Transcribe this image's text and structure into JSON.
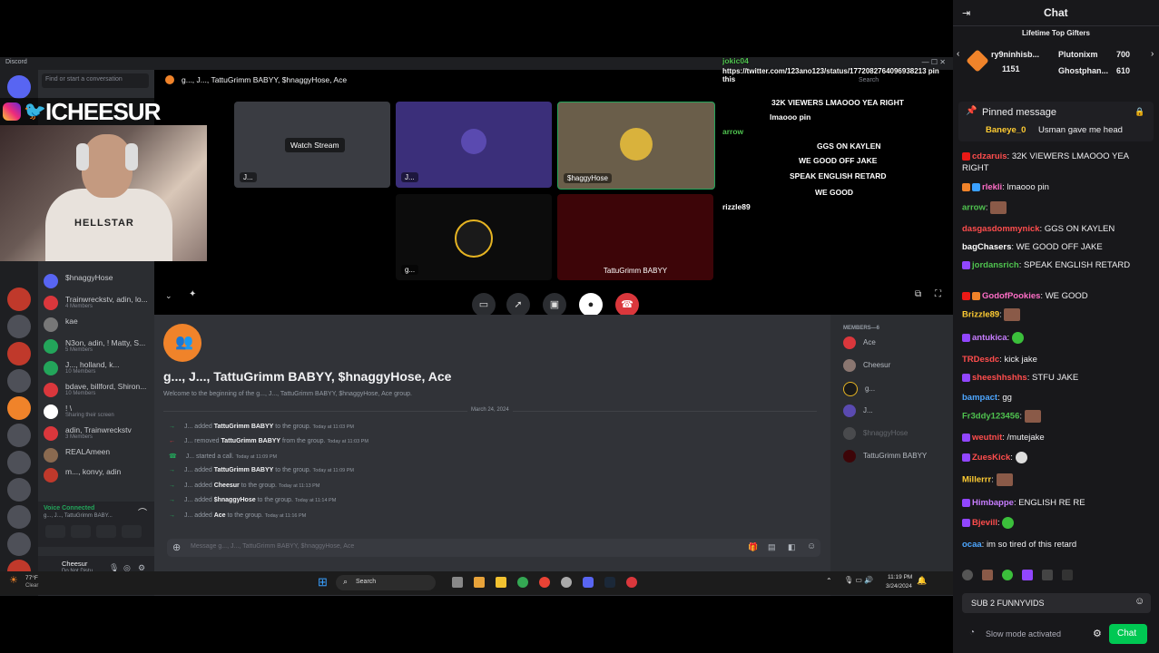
{
  "discord": {
    "brand": "Discord",
    "search_placeholder": "Find or start a conversation",
    "channel_title": "g..., J..., TattuGrimm BABYY, $hnaggyHose, Ace",
    "top_right_search": "Search",
    "dm_list": [
      {
        "name": "$hnaggyHose",
        "sub": ""
      },
      {
        "name": "Trainwreckstv, adin, lo...",
        "sub": "4 Members"
      },
      {
        "name": "kae",
        "sub": ""
      },
      {
        "name": "N3on, adin, ! Matty, S...",
        "sub": "5 Members"
      },
      {
        "name": "J..., holland, k...",
        "sub": "10 Members"
      },
      {
        "name": "bdave, billford, Shiron...",
        "sub": "10 Members"
      },
      {
        "name": "! \\",
        "sub": "Sharing their screen"
      },
      {
        "name": "adin, Trainwreckstv",
        "sub": "3 Members"
      },
      {
        "name": "REALAmeen",
        "sub": ""
      },
      {
        "name": "m..., konvy, adin",
        "sub": ""
      }
    ],
    "voice_connected": "Voice Connected",
    "voice_channel": "g..., J..., TattuGrimm BABY...",
    "user_name": "Cheesur",
    "user_status": "Do Not Distu...",
    "tiles": {
      "watch_stream": "Watch Stream",
      "tile1_label": "J...",
      "tile2_label": "J...",
      "tile3_label": "$haggyHose",
      "tile4_label": "g...",
      "tile5_label": "TattuGrimm BABYY"
    },
    "group_title": "g..., J..., TattuGrimm BABYY, $hnaggyHose, Ace",
    "group_welcome": "Welcome to the beginning of the g..., J..., TattuGrimm BABYY, $hnaggyHose, Ace group.",
    "date_divider": "March 24, 2024",
    "system_messages": [
      {
        "who": "J...",
        "action": "added",
        "target": "TattuGrimm BABYY",
        "rest": "to the group.",
        "time": "Today at 11:03 PM",
        "kind": "join"
      },
      {
        "who": "J...",
        "action": "removed",
        "target": "TattuGrimm BABYY",
        "rest": "from the group.",
        "time": "Today at 11:03 PM",
        "kind": "leave"
      },
      {
        "who": "J...",
        "action": "started a call.",
        "target": "",
        "rest": "",
        "time": "Today at 11:09 PM",
        "kind": "call"
      },
      {
        "who": "J...",
        "action": "added",
        "target": "TattuGrimm BABYY",
        "rest": "to the group.",
        "time": "Today at 11:09 PM",
        "kind": "join"
      },
      {
        "who": "J...",
        "action": "added",
        "target": "Cheesur",
        "rest": "to the group.",
        "time": "Today at 11:13 PM",
        "kind": "join"
      },
      {
        "who": "J...",
        "action": "added",
        "target": "$hnaggyHose",
        "rest": "to the group.",
        "time": "Today at 11:14 PM",
        "kind": "join"
      },
      {
        "who": "J...",
        "action": "added",
        "target": "Ace",
        "rest": "to the group.",
        "time": "Today at 11:16 PM",
        "kind": "join"
      }
    ],
    "message_placeholder": "Message g..., J..., TattuGrimm BABYY, $hnaggyHose, Ace",
    "members_header": "MEMBERS—6",
    "members": [
      "Ace",
      "Cheesur",
      "g...",
      "J...",
      "$hnaggyHose",
      "TattuGrimm BABYY"
    ]
  },
  "streamer": {
    "handle": "ICHEESUR",
    "shirt_text": "HELLSTAR"
  },
  "overlay_chat": [
    {
      "name": "jokic04",
      "text": "",
      "color": "#4fc34f"
    },
    {
      "name": "",
      "text": "https://twitter.com/123ano123/status/1772082764096938213 pin this",
      "color": "#ffffff"
    },
    {
      "name": "",
      "text": "32K VIEWERS LMAOOO YEA RIGHT",
      "color": "#ffffff"
    },
    {
      "name": "",
      "text": "lmaooo pin",
      "color": "#ffffff"
    },
    {
      "name": "arrow",
      "text": "",
      "color": "#4fc34f"
    },
    {
      "name": "",
      "text": "GGS ON KAYLEN",
      "color": "#ffffff"
    },
    {
      "name": "",
      "text": "WE GOOD OFF JAKE",
      "color": "#ffffff"
    },
    {
      "name": "",
      "text": "SPEAK ENGLISH RETARD",
      "color": "#ffffff"
    },
    {
      "name": "",
      "text": "WE GOOD",
      "color": "#ffffff"
    },
    {
      "name": "rizzle89",
      "text": "",
      "color": "#ffffff"
    }
  ],
  "taskbar": {
    "weather_temp": "77°F",
    "weather_desc": "Clear",
    "search": "Search",
    "time": "11:19 PM",
    "date": "3/24/2024"
  },
  "twitch": {
    "header_title": "Chat",
    "top_gifters_title": "Lifetime Top Gifters",
    "gifters": [
      {
        "name": "ry9ninhisb...",
        "count": "1151"
      },
      {
        "name": "Plutonixm",
        "count": "700"
      },
      {
        "name": "Ghostphan...",
        "count": "610"
      }
    ],
    "pinned_title": "Pinned message",
    "pinned_name": "Baneye_0",
    "pinned_text": "Usman gave me head",
    "messages": [
      {
        "name": "cdzaruis",
        "text": "32K VIEWERS LMAOOO YEA RIGHT",
        "color": "#ff4d4d",
        "emote": ""
      },
      {
        "name": "rlekli",
        "text": "lmaooo pin",
        "color": "#ff6ec7",
        "emote": ""
      },
      {
        "name": "arrow",
        "text": "",
        "color": "#4fc34f",
        "emote": "face"
      },
      {
        "name": "dasgasdommynick",
        "text": "GGS ON KAYLEN",
        "color": "#ff4d4d",
        "emote": ""
      },
      {
        "name": "bagChasers",
        "text": "WE GOOD OFF JAKE",
        "color": "#ffffff",
        "emote": ""
      },
      {
        "name": "jordansrich",
        "text": "SPEAK ENGLISH RETARD",
        "color": "#4fc34f",
        "emote": ""
      },
      {
        "name": "GodofPookies",
        "text": "WE GOOD",
        "color": "#ff6ec7",
        "emote": ""
      },
      {
        "name": "Brizzle89",
        "text": "",
        "color": "#ffcc33",
        "emote": "face"
      },
      {
        "name": "antukica",
        "text": "",
        "color": "#c77dff",
        "emote": "green"
      },
      {
        "name": "TRDesdc",
        "text": "kick jake",
        "color": "#ff4d4d",
        "emote": ""
      },
      {
        "name": "sheeshhshhs",
        "text": "STFU JAKE",
        "color": "#ff4d4d",
        "emote": ""
      },
      {
        "name": "bampact",
        "text": "gg",
        "color": "#4da6ff",
        "emote": ""
      },
      {
        "name": "Fr3ddy123456",
        "text": "",
        "color": "#4fc34f",
        "emote": "face"
      },
      {
        "name": "weutnit",
        "text": "/mutejake",
        "color": "#ff4d4d",
        "emote": ""
      },
      {
        "name": "ZuesKick",
        "text": "",
        "color": "#ff4d4d",
        "emote": "skull"
      },
      {
        "name": "Millerrr",
        "text": "",
        "color": "#ffcc33",
        "emote": "face"
      },
      {
        "name": "Himbappe",
        "text": "ENGLISH RE RE",
        "color": "#c77dff",
        "emote": ""
      },
      {
        "name": "Bjevill",
        "text": "",
        "color": "#ff4d4d",
        "emote": "green"
      },
      {
        "name": "ocaa",
        "text": "im so tired of this retard",
        "color": "#4da6ff",
        "emote": ""
      }
    ],
    "input_value": "SUB 2 FUNNYVIDS",
    "slow_mode": "Slow mode activated",
    "chat_button": "Chat"
  },
  "colors": {
    "discord_bg": "#313338",
    "discord_sidebar": "#2b2d31",
    "twitch_bg": "#18181b",
    "twitch_accent": "#00c853",
    "hangup_red": "#da373c"
  }
}
